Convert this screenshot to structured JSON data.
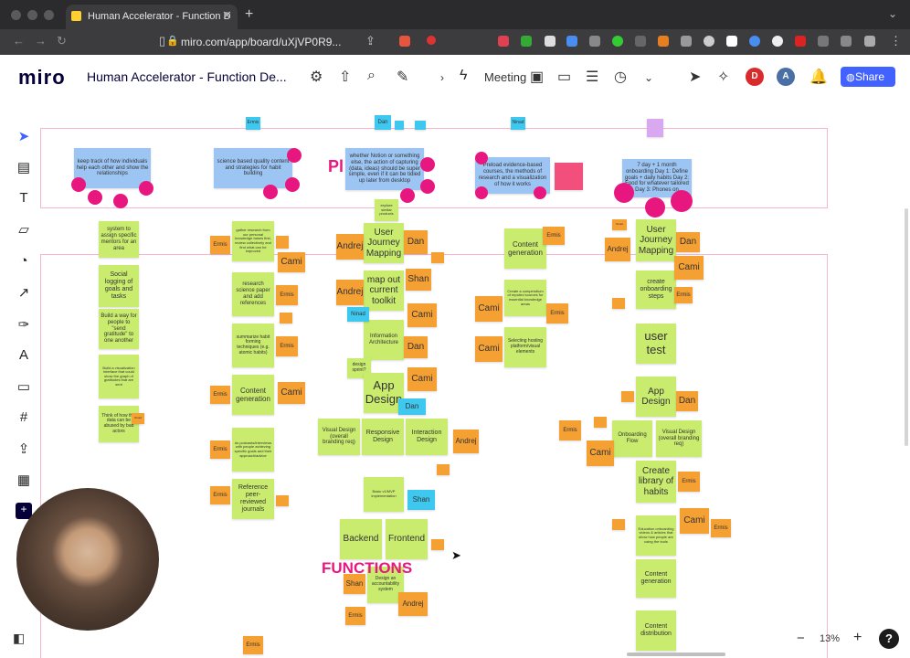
{
  "browser": {
    "tab_title": "Human Accelerator - Function D",
    "url": "miro.com/app/board/uXjVP0R9..."
  },
  "app": {
    "logo": "miro",
    "board_title": "Human Accelerator - Function De...",
    "meeting_label": "Meeting",
    "share_label": "Share",
    "avatar_d": "D",
    "avatar_a": "A"
  },
  "canvas": {
    "functions_label": "FUNCTIONS",
    "pl_label": "Pl",
    "zoom": "13%",
    "help": "?"
  },
  "stickies": [
    {
      "t": "keep track of how individuals help each other and show the relationships"
    },
    {
      "t": "science based quality content and strategies for habit building"
    },
    {
      "t": "whether Notion or something else, the action of capturing (data, ideas) should be super simple, even if it can be tidied up later from desktop"
    },
    {
      "t": "Preload evidence-based courses, the methods of research and a visualization of how it works"
    },
    {
      "t": "7 day + 1 month onboarding Day 1: Define goals + daily habits Day 2: Food for whatever tailored Day 3: Phones on"
    },
    {
      "t": "system to assign specific mentors for an area"
    },
    {
      "t": "Social logging of goals and tasks"
    },
    {
      "t": "Build a way for people to \"send gratitude\" to one another"
    },
    {
      "t": "Build a visualization interface that could show the graph of gratitudes that are sent"
    },
    {
      "t": "Think of how this data can be abused by bad actors"
    },
    {
      "t": "gather research from our personal knowledge bases first, review collectively and find what can be improved"
    },
    {
      "t": "research science paper and add references"
    },
    {
      "t": "summarize habit forming techniques (e.g. atomic habits)"
    },
    {
      "t": "Content generation"
    },
    {
      "t": "do podcasts/interviews with people achieving specific goals and their approach/advice"
    },
    {
      "t": "Reference peer-reviewed journals"
    },
    {
      "t": "explore similar products"
    },
    {
      "t": "User Journey Mapping"
    },
    {
      "t": "map out current toolkit"
    },
    {
      "t": "Information Architecture"
    },
    {
      "t": "design sprint?"
    },
    {
      "t": "App Design"
    },
    {
      "t": "Visual Design (overall branding req)"
    },
    {
      "t": "Responsive Design"
    },
    {
      "t": "Interaction Design"
    },
    {
      "t": "Basic v1/MVP implementation"
    },
    {
      "t": "Backend"
    },
    {
      "t": "Frontend"
    },
    {
      "t": "Design an accountability system"
    },
    {
      "t": "Content generation"
    },
    {
      "t": "Create a compendium of reputed sources for essential knowledge areas"
    },
    {
      "t": "Selecting hosting platform/visual elements"
    },
    {
      "t": "User Journey Mapping"
    },
    {
      "t": "create onboarding steps"
    },
    {
      "t": "user test"
    },
    {
      "t": "App Design"
    },
    {
      "t": "Onboarding Flow"
    },
    {
      "t": "Visual Design (overall branding req)"
    },
    {
      "t": "Create library of habits"
    },
    {
      "t": "Education onboarding videos & articles that show how people are using the tools"
    },
    {
      "t": "Content generation"
    },
    {
      "t": "Content distribution"
    },
    {
      "t": "Ermis"
    },
    {
      "t": "Cami"
    },
    {
      "t": "Andrej"
    },
    {
      "t": "Dan"
    },
    {
      "t": "Shan"
    },
    {
      "t": "Ninad"
    }
  ]
}
